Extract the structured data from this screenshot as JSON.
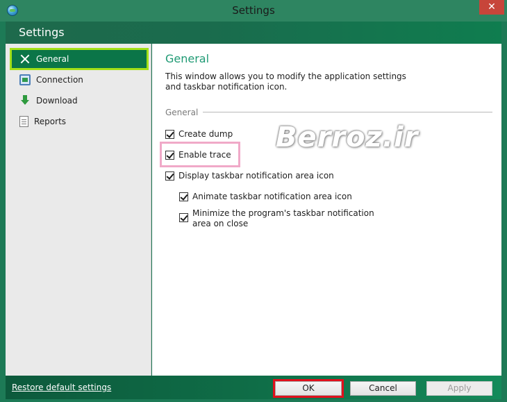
{
  "window": {
    "title": "Settings",
    "close_glyph": "✕"
  },
  "header": {
    "title": "Settings"
  },
  "sidebar": {
    "items": [
      {
        "label": "General",
        "icon": "tools-icon",
        "selected": true
      },
      {
        "label": "Connection",
        "icon": "connection-icon",
        "selected": false
      },
      {
        "label": "Download",
        "icon": "download-icon",
        "selected": false
      },
      {
        "label": "Reports",
        "icon": "reports-icon",
        "selected": false
      }
    ]
  },
  "main": {
    "title": "General",
    "description": "This window allows you to modify the application settings and taskbar notification icon.",
    "group_label": "General",
    "options": [
      {
        "label": "Create dump",
        "checked": true
      },
      {
        "label": "Enable trace",
        "checked": true
      },
      {
        "label": "Display taskbar notification area icon",
        "checked": true
      },
      {
        "label": "Animate taskbar notification area icon",
        "checked": true
      },
      {
        "label": "Minimize the program's taskbar notification area on close",
        "checked": true
      }
    ]
  },
  "watermark": "Berroz.ir",
  "footer": {
    "restore_label": "Restore default settings",
    "ok_label": "OK",
    "cancel_label": "Cancel",
    "apply_label": "Apply"
  },
  "colors": {
    "accent": "#0b7548",
    "selection_outline": "#a3e018",
    "title_color": "#1f9a74",
    "highlight_pink": "#f0a9c8",
    "highlight_red": "#e0101c"
  }
}
